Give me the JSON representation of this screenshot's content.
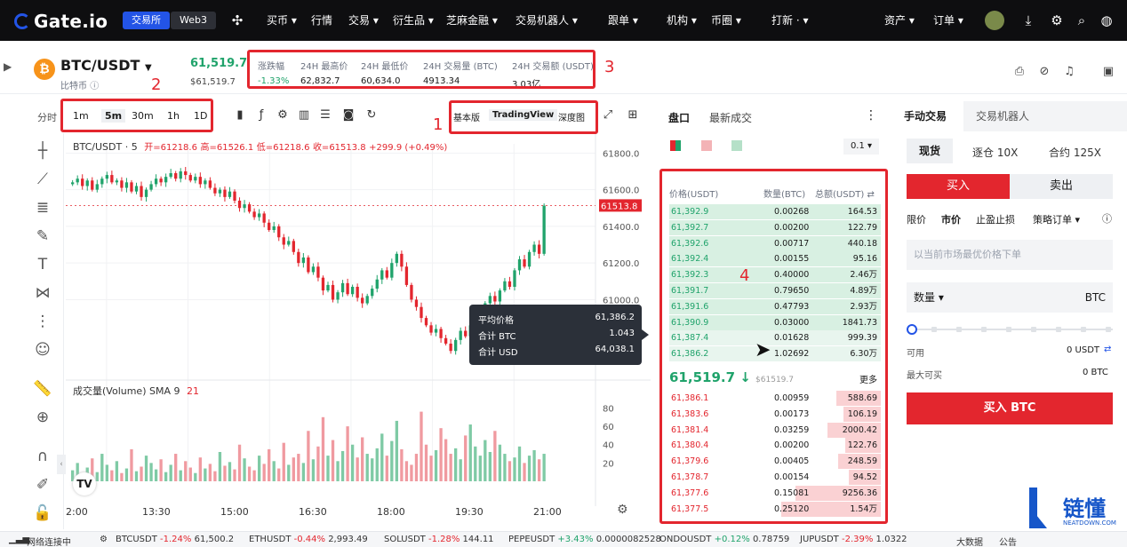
{
  "nav": {
    "brand": "Gate.io",
    "exchange": "交易所",
    "web3": "Web3",
    "items": [
      {
        "key": "buy",
        "label": "买币 ▾"
      },
      {
        "key": "market",
        "label": "行情"
      },
      {
        "key": "trade",
        "label": "交易 ▾"
      },
      {
        "key": "deriv",
        "label": "衍生品 ▾"
      },
      {
        "key": "finance",
        "label": "芝麻金融 ▾"
      },
      {
        "key": "bot",
        "label": "交易机器人 ▾"
      },
      {
        "key": "copy",
        "label": "跟单 ▾"
      },
      {
        "key": "inst",
        "label": "机构 ▾"
      },
      {
        "key": "circle",
        "label": "币圈 ▾"
      },
      {
        "key": "new",
        "label": "打新 · ▾"
      }
    ],
    "assets": "资产 ▾",
    "orders": "订单 ▾"
  },
  "header": {
    "pair": "BTC/USDT",
    "coin_name": "比特币",
    "last_price": "61,519.7",
    "last_usd": "$61,519.7",
    "stats": [
      {
        "label": "涨跌幅",
        "value": "-1.33%"
      },
      {
        "label": "24H 最高价",
        "value": "62,832.7"
      },
      {
        "label": "24H 最低价",
        "value": "60,634.0"
      },
      {
        "label": "24H 交易量 (BTC)",
        "value": "4913.34"
      },
      {
        "label": "24H 交易额 (USDT)",
        "value": "3.03亿"
      }
    ]
  },
  "annot": {
    "n1": "1",
    "n2": "2",
    "n3": "3",
    "n4": "4"
  },
  "toolbar": {
    "fen": "分时",
    "intervals": [
      "1m",
      "5m",
      "30m",
      "1h",
      "1D"
    ],
    "active": "5m",
    "views": [
      "基本版",
      "TradingView",
      "深度图"
    ],
    "active_view": "TradingView"
  },
  "chart_data": [
    {
      "type": "candlestick",
      "title": "BTC/USDT · 5",
      "ohlc_label": {
        "open": "开=61218.6",
        "high": "高=61526.1",
        "low": "低=61218.6",
        "close": "收=61513.8",
        "change": "+299.9 (+0.49%)"
      },
      "y_ticks": [
        "61800.0",
        "61600.0",
        "61400.0",
        "61200.0",
        "61000.0"
      ],
      "ylim": [
        60600,
        61850
      ],
      "current_price": "61513.8",
      "current": 61513.8,
      "x_ticks": [
        "2:00",
        "13:30",
        "15:00",
        "16:30",
        "18:00",
        "19:30",
        "21:00"
      ],
      "closes": [
        61640,
        61660,
        61620,
        61650,
        61600,
        61630,
        61660,
        61680,
        61640,
        61650,
        61610,
        61640,
        61590,
        61620,
        61560,
        61600,
        61630,
        61660,
        61640,
        61670,
        61690,
        61660,
        61700,
        61680,
        61650,
        61670,
        61630,
        61650,
        61610,
        61580,
        61600,
        61560,
        61590,
        61540,
        61500,
        61520,
        61480,
        61450,
        61470,
        61420,
        61380,
        61400,
        61340,
        61300,
        61320,
        61260,
        61200,
        61230,
        61150,
        61180,
        61120,
        61050,
        61080,
        61000,
        61040,
        61090,
        61030,
        61070,
        61010,
        60980,
        61020,
        61060,
        61110,
        61160,
        61120,
        61200,
        61250,
        61180,
        61080,
        61000,
        60960,
        60900,
        60860,
        60820,
        60840,
        60790,
        60760,
        60720,
        60780,
        60830,
        60800,
        60860,
        60900,
        60940,
        60980,
        61020,
        60990,
        61050,
        61100,
        61070,
        61160,
        61220,
        61180,
        61260,
        61300,
        61250,
        61513
      ]
    },
    {
      "type": "bar",
      "title": "成交量(Volume) SMA 9",
      "sma": "21",
      "y_ticks": [
        "80",
        "60",
        "40",
        "20"
      ],
      "ylim": [
        0,
        95
      ],
      "values": [
        12,
        20,
        8,
        15,
        25,
        10,
        30,
        18,
        12,
        22,
        9,
        14,
        35,
        11,
        16,
        28,
        20,
        13,
        24,
        10,
        18,
        30,
        12,
        22,
        15,
        9,
        26,
        14,
        19,
        11,
        32,
        17,
        21,
        13,
        40,
        25,
        16,
        12,
        28,
        19,
        35,
        22,
        14,
        42,
        18,
        26,
        30,
        20,
        55,
        24,
        38,
        70,
        28,
        45,
        22,
        33,
        60,
        40,
        26,
        48,
        30,
        25,
        36,
        52,
        28,
        44,
        66,
        35,
        22,
        18,
        30,
        76,
        40,
        28,
        34,
        58,
        46,
        30,
        36,
        24,
        50,
        62,
        38,
        28,
        45,
        32,
        55,
        40,
        30,
        22,
        26,
        38,
        20,
        28,
        34,
        24,
        30
      ]
    }
  ],
  "tooltip": {
    "rows": [
      {
        "label": "平均价格",
        "value": "61,386.2"
      },
      {
        "label": "合计 BTC",
        "value": "1.043"
      },
      {
        "label": "合计 USD",
        "value": "64,038.1"
      }
    ]
  },
  "orderbook": {
    "tabs": [
      "盘口",
      "最新成交"
    ],
    "precision": "0.1 ▾",
    "headers": [
      "价格(USDT)",
      "数量(BTC)",
      "总额(USDT) ⇄"
    ],
    "bids_top": [
      {
        "p": "61,392.9",
        "q": "0.00268",
        "t": "164.53"
      },
      {
        "p": "61,392.7",
        "q": "0.00200",
        "t": "122.79"
      },
      {
        "p": "61,392.6",
        "q": "0.00717",
        "t": "440.18"
      },
      {
        "p": "61,392.4",
        "q": "0.00155",
        "t": "95.16"
      },
      {
        "p": "61,392.3",
        "q": "0.40000",
        "t": "2.46万"
      },
      {
        "p": "61,391.7",
        "q": "0.79650",
        "t": "4.89万"
      },
      {
        "p": "61,391.6",
        "q": "0.47793",
        "t": "2.93万"
      },
      {
        "p": "61,390.9",
        "q": "0.03000",
        "t": "1841.73"
      },
      {
        "p": "61,387.4",
        "q": "0.01628",
        "t": "999.39"
      },
      {
        "p": "61,386.2",
        "q": "1.02692",
        "t": "6.30万"
      }
    ],
    "mid_price": "61,519.7 ↓",
    "mid_usd": "$61519.7",
    "more": "更多",
    "asks": [
      {
        "p": "61,386.1",
        "q": "0.00959",
        "t": "588.69"
      },
      {
        "p": "61,383.6",
        "q": "0.00173",
        "t": "106.19"
      },
      {
        "p": "61,381.4",
        "q": "0.03259",
        "t": "2000.42"
      },
      {
        "p": "61,380.4",
        "q": "0.00200",
        "t": "122.76"
      },
      {
        "p": "61,379.6",
        "q": "0.00405",
        "t": "248.59"
      },
      {
        "p": "61,378.7",
        "q": "0.00154",
        "t": "94.52"
      },
      {
        "p": "61,377.6",
        "q": "0.15081",
        "t": "9256.36"
      },
      {
        "p": "61,377.5",
        "q": "0.25120",
        "t": "1.54万"
      }
    ]
  },
  "trade": {
    "tabs": [
      "手动交易",
      "交易机器人"
    ],
    "modes": [
      "现货",
      "逐仓 10X",
      "合约 125X"
    ],
    "buy": "买入",
    "sell": "卖出",
    "types": [
      "限价",
      "市价",
      "止盈止损",
      "策略订单 ▾"
    ],
    "market_placeholder": "以当前市场最优价格下单",
    "qty_label": "数量 ▾",
    "qty_unit": "BTC",
    "avail_label": "可用",
    "avail_value": "0 USDT",
    "max_label": "最大可买",
    "max_value": "0 BTC",
    "submit": "买入 BTC"
  },
  "status": {
    "net": "网络连接中",
    "tickers": [
      {
        "s": "BTCUSDT",
        "c": "-1.24%",
        "p": "61,500.2",
        "up": false
      },
      {
        "s": "ETHUSDT",
        "c": "-0.44%",
        "p": "2,993.49",
        "up": false
      },
      {
        "s": "SOLUSDT",
        "c": "-1.28%",
        "p": "144.11",
        "up": false
      },
      {
        "s": "PEPEUSDT",
        "c": "+3.43%",
        "p": "0.0000082528",
        "up": true
      },
      {
        "s": "ONDOUSDT",
        "c": "+0.12%",
        "p": "0.78759",
        "up": true
      },
      {
        "s": "JUPUSDT",
        "c": "-2.39%",
        "p": "1.0322",
        "up": false
      }
    ],
    "bigdata": "大数据",
    "notice": "公告"
  },
  "watermark": {
    "cn": "链懂",
    "en": "NEATDOWN.COM"
  },
  "colors": {
    "up": "#20a36b",
    "down": "#e3262e",
    "accent": "#e3262e",
    "brand": "#2354e6"
  }
}
